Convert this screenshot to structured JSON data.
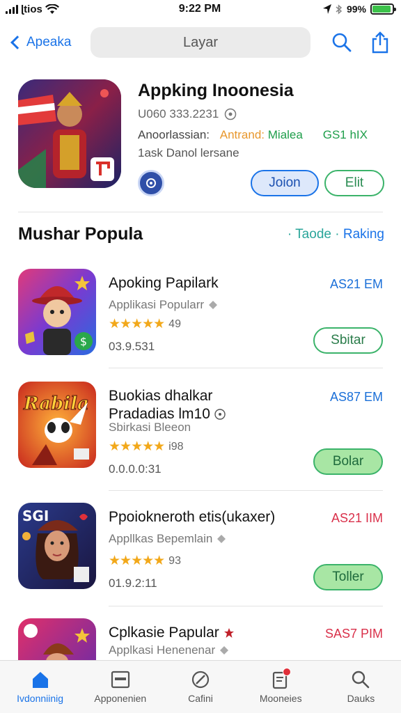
{
  "status_bar": {
    "carrier": "ɭtios",
    "time": "9:22 PM",
    "battery": "99%",
    "battery_level": 0.93,
    "icons": [
      "signal-icon",
      "wifi-icon",
      "location-icon",
      "bluetooth-icon",
      "battery-icon"
    ]
  },
  "nav": {
    "back_label": "Apeaka",
    "search_text": "Layar",
    "icons": [
      "search-icon",
      "share-icon"
    ]
  },
  "hero": {
    "title": "Appking Inoonesia",
    "stats": "U060 333.2231",
    "tag_prefix": "Anoorlassian:",
    "tag_orange": "Antrand:",
    "tag_green": "Mialea",
    "price": "GS1 hIX",
    "subtitle": "1ask Danol lersane",
    "join_label": "Joion",
    "edit_label": "Elit"
  },
  "section": {
    "title": "Mushar Popula",
    "link_teal": "· Taode ·",
    "link_blue": "Raking"
  },
  "apps": [
    {
      "name": "Apoking Papilark",
      "category": "Applikasi Popularr",
      "stars": "★★★★★",
      "rating": "49",
      "size": "03.9.531",
      "price": "AS21 EM",
      "price_color": "#1a6fd8",
      "button": "Sbitar",
      "button_style": "outline"
    },
    {
      "name": "Buokias dhalkar Pradadias lm10",
      "category": "Sbirkasi Bleeon",
      "stars": "★★★★★",
      "rating": "i98",
      "size": "0.0.0.0:31",
      "price": "AS87 EM",
      "price_color": "#1a6fd8",
      "button": "Bolar",
      "button_style": "filled"
    },
    {
      "name": "Ppoiokneroth etis(ukaxer)",
      "category": "Appllkas Bepemlain",
      "stars": "★★★★★",
      "rating": "93",
      "size": "01.9.2:11",
      "price": "AS21 IIM",
      "price_color": "#d9304a",
      "button": "Toller",
      "button_style": "filled"
    },
    {
      "name": "Cplkasie Papular",
      "category": "Applkasi Henenenar",
      "stars": "",
      "rating": "",
      "size": "",
      "price": "SAS7 PIM",
      "price_color": "#d9304a",
      "button": "",
      "button_style": "none"
    }
  ],
  "tabs": [
    {
      "label": "Ivdonniinig",
      "icon": "home-icon",
      "active": true
    },
    {
      "label": "Apponenien",
      "icon": "apps-icon",
      "active": false
    },
    {
      "label": "Cafini",
      "icon": "games-icon",
      "active": false
    },
    {
      "label": "Mooneies",
      "icon": "updates-icon",
      "active": false
    },
    {
      "label": "Dauks",
      "icon": "search-icon",
      "active": false
    }
  ]
}
